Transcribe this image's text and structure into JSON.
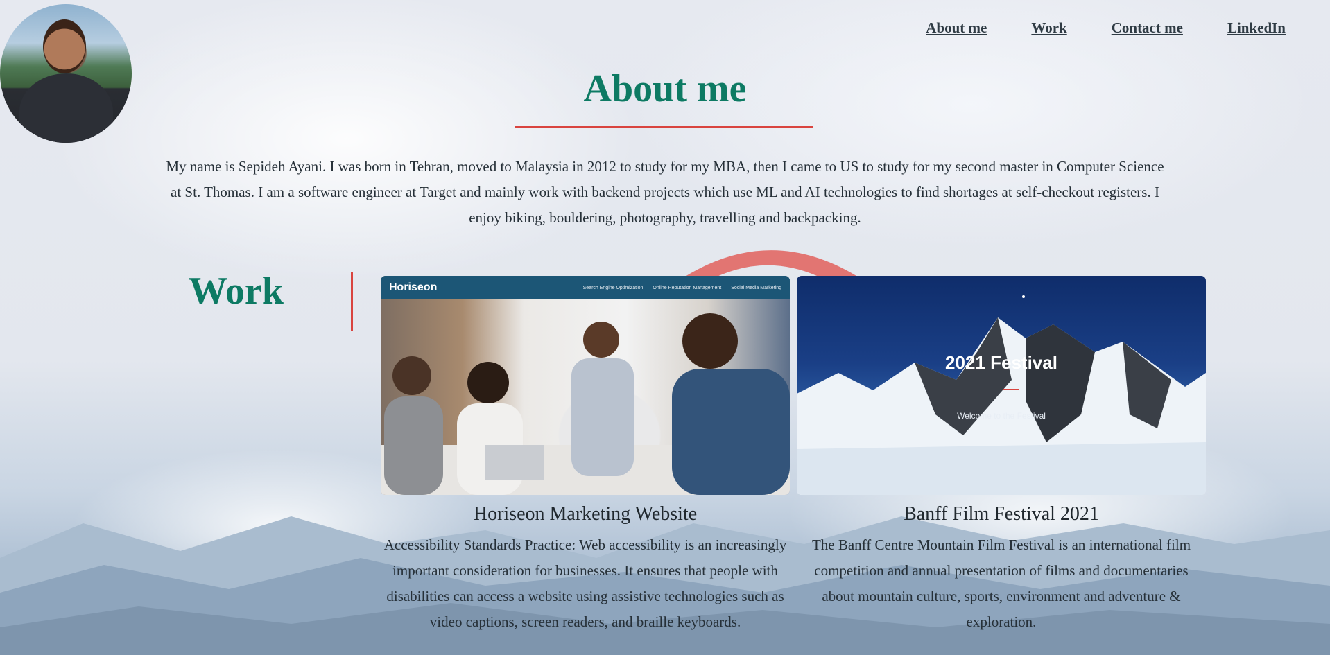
{
  "nav": {
    "about": "About me",
    "work": "Work",
    "contact": "Contact me",
    "linkedin": "LinkedIn"
  },
  "about": {
    "title": "About me",
    "bio": "My name is Sepideh Ayani. I was born in Tehran, moved to Malaysia in 2012 to study for my MBA, then I came to US to study for my second master in Computer Science at St. Thomas. I am a software engineer at Target and mainly work with backend projects which use ML and AI technologies to find shortages at self-checkout registers. I enjoy biking, bouldering, photography, travelling and backpacking."
  },
  "work": {
    "title": "Work",
    "projects": [
      {
        "title": "Horiseon Marketing Website",
        "description": "Accessibility Standards Practice: Web accessibility is an increasingly important consideration for businesses. It ensures that people with disabilities can access a website using assistive technologies such as video captions, screen readers, and braille keyboards.",
        "thumb": {
          "brand": "Horiseon",
          "links": [
            "Search Engine Optimization",
            "Online Reputation Management",
            "Social Media Marketing"
          ]
        }
      },
      {
        "title": "Banff Film Festival 2021",
        "description": "The Banff Centre Mountain Film Festival is an international film competition and annual presentation of films and documentaries about mountain culture, sports, environment and adventure & exploration.",
        "thumb": {
          "heading": "2021 Festival",
          "subheading": "Welcome to the Festival"
        }
      }
    ]
  },
  "colors": {
    "heading": "#0d7a63",
    "accent": "#d9443f",
    "nav": "#2f3b44"
  }
}
